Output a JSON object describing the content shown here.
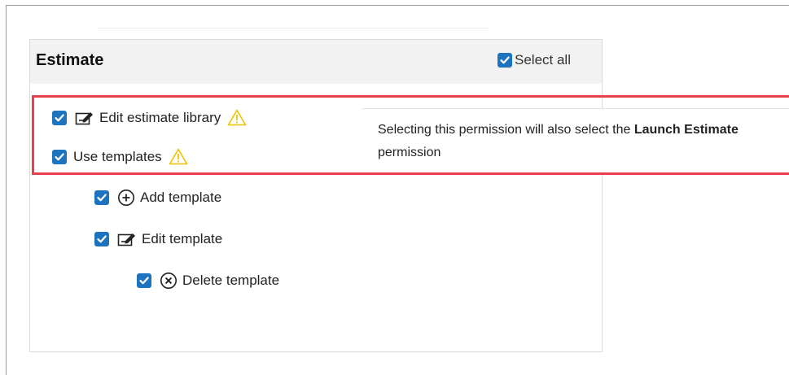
{
  "panel": {
    "title": "Estimate",
    "select_all_label": "Select all"
  },
  "permissions": [
    {
      "label": "Edit estimate library",
      "icon": "edit-icon",
      "checked": true,
      "warning": true
    },
    {
      "label": "Use templates",
      "icon": null,
      "checked": true,
      "warning": true
    },
    {
      "label": "Add template",
      "icon": "add-circle-icon",
      "checked": true,
      "warning": false
    },
    {
      "label": "Edit template",
      "icon": "edit-icon",
      "checked": true,
      "warning": false
    },
    {
      "label": "Delete template",
      "icon": "delete-circle-icon",
      "checked": true,
      "warning": false
    }
  ],
  "tooltip": {
    "text_before": "Selecting this permission will also select the ",
    "bold": "Launch Estimate",
    "text_after": " permission"
  },
  "colors": {
    "checkbox": "#1e73be",
    "warning": "#f2c200",
    "highlight": "#e8404a",
    "header_bg": "#f2f2f2"
  }
}
